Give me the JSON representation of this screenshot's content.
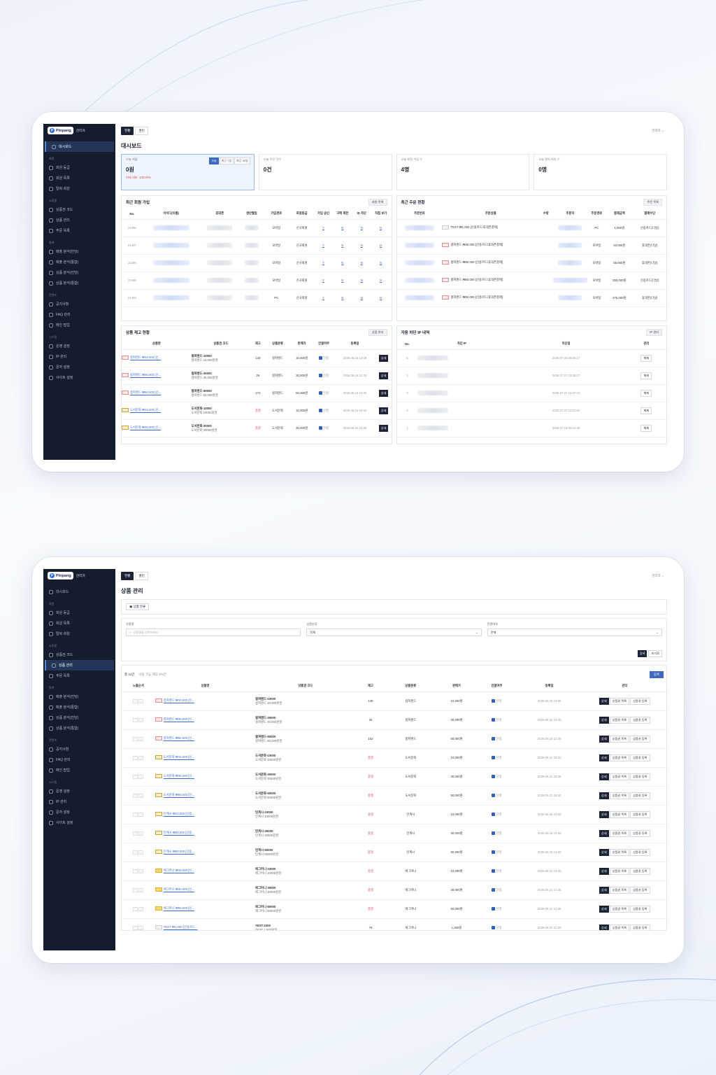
{
  "app": {
    "brand": "Pinpang",
    "role": "관리자",
    "tabs": [
      "현황",
      "쿨린"
    ],
    "user": "관리자 ⌄"
  },
  "sidebar": {
    "f1": [
      {
        "type": "item",
        "label": "대시보드",
        "icon": "dashboard-icon",
        "active": true
      },
      {
        "type": "sec",
        "label": "회원"
      },
      {
        "type": "item",
        "label": "회원 등급",
        "icon": "award-icon"
      },
      {
        "type": "item",
        "label": "회원 목록",
        "icon": "users-icon"
      },
      {
        "type": "item",
        "label": "탈퇴 회원",
        "icon": "user-x-icon"
      },
      {
        "type": "sec",
        "label": "쇼핑몰"
      },
      {
        "type": "item",
        "label": "상품권 코드",
        "icon": "ticket-icon"
      },
      {
        "type": "item",
        "label": "상품 관리",
        "icon": "box-icon"
      },
      {
        "type": "item",
        "label": "주문 목록",
        "icon": "cart-icon"
      },
      {
        "type": "sec",
        "label": "통계"
      },
      {
        "type": "item",
        "label": "매출 분석(빈당)",
        "icon": "chart-icon"
      },
      {
        "type": "item",
        "label": "매출 분석(통합)",
        "icon": "chart-icon"
      },
      {
        "type": "item",
        "label": "상품 분석(빈당)",
        "icon": "pie-icon"
      },
      {
        "type": "item",
        "label": "상품 분석(통합)",
        "icon": "pie-icon"
      },
      {
        "type": "sec",
        "label": "콘텐츠"
      },
      {
        "type": "item",
        "label": "공지사항",
        "icon": "bell-icon"
      },
      {
        "type": "item",
        "label": "FAQ 관리",
        "icon": "help-icon"
      },
      {
        "type": "item",
        "label": "메인 팝업",
        "icon": "popup-icon"
      },
      {
        "type": "sec",
        "label": "시스템"
      },
      {
        "type": "item",
        "label": "운영 설정",
        "icon": "sliders-icon"
      },
      {
        "type": "item",
        "label": "IP 관리",
        "icon": "shield-icon"
      },
      {
        "type": "item",
        "label": "문자 설정",
        "icon": "message-icon"
      },
      {
        "type": "item",
        "label": "사이트 설정",
        "icon": "settings-icon"
      }
    ],
    "f2_active": "상품 관리"
  },
  "dashboard": {
    "title": "대시보드",
    "stats": [
      {
        "label": "오늘 매출",
        "value": "0원",
        "delta": "어제 대비 -100.00%",
        "buttons": [
          "오늘",
          "최근 7일",
          "최근 30일"
        ]
      },
      {
        "label": "오늘 주문 건수",
        "value": "0건"
      },
      {
        "label": "오늘 회원 가입 수",
        "value": "4명"
      },
      {
        "label": "오늘 탈퇴 회원 수",
        "value": "0명"
      }
    ],
    "members": {
      "title": "최근 회원 가입",
      "button": "회원 목록",
      "headers": [
        "No.",
        "아이디(이름)",
        "휴대폰",
        "생년월일",
        "가입경로",
        "회원등급",
        "가입 승인",
        "구매 제한",
        "ID 차단",
        "직접 보기"
      ],
      "rows": [
        {
          "no": "21498",
          "route": "모바일",
          "grade": "신규회원",
          "a": "Y",
          "b": "N",
          "c": "N",
          "d": "N"
        },
        {
          "no": "21497",
          "route": "모바일",
          "grade": "신규회원",
          "a": "Y",
          "b": "N",
          "c": "N",
          "d": "N"
        },
        {
          "no": "21496",
          "route": "모바일",
          "grade": "신규회원",
          "a": "Y",
          "b": "N",
          "c": "N",
          "d": "N"
        },
        {
          "no": "21495",
          "route": "모바일",
          "grade": "신규회원",
          "a": "Y",
          "b": "N",
          "c": "N",
          "d": "N"
        },
        {
          "no": "21494",
          "route": "PC",
          "grade": "신규회원",
          "a": "Y",
          "b": "N",
          "c": "N",
          "d": "N"
        }
      ]
    },
    "orders": {
      "title": "최근 주문 현황",
      "button": "주문 목록",
      "headers": [
        "주문번호",
        "주문상품",
        "수량",
        "주문자",
        "주문경로",
        "결제금액",
        "결제수단"
      ],
      "rows": [
        {
          "product": "TEST ₩1,000 [신용카드/휴대폰결제]",
          "channel": "PC",
          "amount": "1,000원",
          "method": "신용카드(다날)"
        },
        {
          "product": "컬쳐랜드 ₩30,000 [신용카드/휴대폰결제]",
          "channel": "모바일",
          "amount": "33,000원",
          "method": "휴대폰(다날)"
        },
        {
          "product": "컬쳐랜드 ₩50,000 [신용카드/휴대폰결제]",
          "channel": "모바일",
          "amount": "55,000원",
          "method": "휴대폰(다날)"
        },
        {
          "product": "컬쳐랜드 ₩50,000 [신용카드/휴대폰결제]",
          "channel": "모바일",
          "amount": "250,000원",
          "method": "신용카드(다날)"
        },
        {
          "product": "컬쳐랜드 ₩50,000 [신용카드/휴대폰결제]",
          "channel": "모바일",
          "amount": "275,000원",
          "method": "휴대폰(다날)"
        }
      ]
    },
    "stock": {
      "title": "상품 재고 현황",
      "button": "상품 관리",
      "headers": [
        "상품명",
        "상품권 코드",
        "재고",
        "상품분류",
        "판매가",
        "진열여부",
        "등록일",
        ""
      ],
      "rows": [
        {
          "name": "컬쳐랜드 ₩10,000 [신...",
          "code": "컬쳐랜드-10000",
          "sub": "컬쳐랜드 10,000원권",
          "stock": "149",
          "cat": "컬쳐랜드",
          "price": "10,000원",
          "show": "진열",
          "date": "2026.06.15 13:08",
          "btn": "상세"
        },
        {
          "name": "컬쳐랜드 ₩30,000 [신...",
          "code": "컬쳐랜드-30000",
          "sub": "컬쳐랜드 30,000원권",
          "stock": "26",
          "cat": "컬쳐랜드",
          "price": "30,000원",
          "show": "진열",
          "date": "2026.06.16 12:43",
          "btn": "상세"
        },
        {
          "name": "컬쳐랜드 ₩50,000 [신...",
          "code": "컬쳐랜드-50000",
          "sub": "컬쳐랜드 50,000원권",
          "stock": "172",
          "cat": "컬쳐랜드",
          "price": "50,000원",
          "show": "진열",
          "date": "2026.06.16 12:46",
          "btn": "상세"
        },
        {
          "name": "도서문화 ₩10,000 [신...",
          "code": "도서문화-10000",
          "sub": "도서문화 10000원권",
          "stock": "품절",
          "cat": "도서문화",
          "price": "10,000원",
          "show": "진열",
          "date": "2026.06.21 19:34",
          "btn": "상세"
        },
        {
          "name": "도서문화 ₩30,000 [신...",
          "code": "도서문화-30000",
          "sub": "도서문화 30000원권",
          "stock": "품절",
          "cat": "도서문화",
          "price": "30,000원",
          "show": "진열",
          "date": "2026.06.21 19:36",
          "btn": "상세"
        }
      ]
    },
    "ipblock": {
      "title": "자동 차단 IP 내역",
      "button": "IP 관리",
      "headers": [
        "No.",
        "차단 IP",
        "차단일",
        "관리"
      ],
      "rows": [
        {
          "no": "5",
          "date": "2026.07.28 06:58:17",
          "btn": "해제"
        },
        {
          "no": "4",
          "date": "2026.07.27 22:45:27",
          "btn": "해제"
        },
        {
          "no": "3",
          "date": "2026.07.27 11:07:44",
          "btn": "해제"
        },
        {
          "no": "2",
          "date": "2026.07.27 11:01:51",
          "btn": "해제"
        },
        {
          "no": "1",
          "date": "2026.07.18 06:31:45",
          "btn": "해제"
        }
      ]
    }
  },
  "products": {
    "title": "상품 관리",
    "category_button": "상품 분류",
    "filters": {
      "name_label": "상품명",
      "name_placeholder": "상품명을 입력하세요",
      "cat_label": "상품분류",
      "cat_value": "전체",
      "show_label": "진열여부",
      "show_value": "전체",
      "search": "검색",
      "reset": "초기화"
    },
    "count": "총 13건",
    "count_sub": "사용 가능 재고 4%건",
    "register": "등록",
    "headers": [
      "노출순서",
      "상품명",
      "상품권 코드",
      "재고",
      "상품분류",
      "판매가",
      "진열여부",
      "등록일",
      "관리"
    ],
    "actions": [
      "상세",
      "상품권 목록",
      "상품권 등록"
    ],
    "rows": [
      {
        "name": "컬쳐랜드 ₩10,000 [신...",
        "code": "컬쳐랜드-10000",
        "sub": "컬쳐랜드 10,000원권",
        "stock": "149",
        "cat": "컬쳐랜드",
        "price": "10,000원",
        "show": "진열",
        "date": "2026.06.15 13:08",
        "th": "r"
      },
      {
        "name": "컬쳐랜드 ₩30,000 [신...",
        "code": "컬쳐랜드-30000",
        "sub": "컬쳐랜드 30,000원권",
        "stock": "26",
        "cat": "컬쳐랜드",
        "price": "30,000원",
        "show": "진열",
        "date": "2026.06.16 12:43",
        "th": "r"
      },
      {
        "name": "컬쳐랜드 ₩50,000 [신...",
        "code": "컬쳐랜드-50000",
        "sub": "컬쳐랜드 50,000원권",
        "stock": "162",
        "cat": "컬쳐랜드",
        "price": "50,000원",
        "show": "진열",
        "date": "2026.06.16 12:46",
        "th": "r"
      },
      {
        "name": "도서문화 ₩10,000 [신...",
        "code": "도서문화-10000",
        "sub": "도서문화 10000원권",
        "stock": "품절",
        "cat": "도서문화",
        "price": "10,000원",
        "show": "진열",
        "date": "2026.06.21 19:34",
        "th": "y"
      },
      {
        "name": "도서문화 ₩30,000 [신...",
        "code": "도서문화-30000",
        "sub": "도서문화 30000원권",
        "stock": "품절",
        "cat": "도서문화",
        "price": "30,000원",
        "show": "진열",
        "date": "2026.06.21 19:36",
        "th": "y"
      },
      {
        "name": "도서문화 ₩50,000 [신...",
        "code": "도서문화-50000",
        "sub": "도서문화 50000원권",
        "stock": "품절",
        "cat": "도서문화",
        "price": "50,000원",
        "show": "진열",
        "date": "2026.06.21 19:42",
        "th": "y"
      },
      {
        "name": "틴캐시 ₩10,000 [신용...",
        "code": "틴캐시-10000",
        "sub": "틴캐시 10000원권",
        "stock": "품절",
        "cat": "틴캐시",
        "price": "10,000원",
        "show": "진열",
        "date": "2026.06.16 13:03",
        "th": "y"
      },
      {
        "name": "틴캐시 ₩30,000 [신용...",
        "code": "틴캐시-30000",
        "sub": "틴캐시 30000원권",
        "stock": "품절",
        "cat": "틴캐시",
        "price": "30,000원",
        "show": "진열",
        "date": "2026.06.16 14:02",
        "th": "y"
      },
      {
        "name": "틴캐시 ₩50,000 [신용...",
        "code": "틴캐시-50000",
        "sub": "틴캐시 50000원권",
        "stock": "품절",
        "cat": "틴캐시",
        "price": "50,000원",
        "show": "진열",
        "date": "2026.06.16 14:03",
        "th": "y"
      },
      {
        "name": "에그머니 ₩10,000 [신...",
        "code": "에그머니-10000",
        "sub": "에그머니 10000원권",
        "stock": "품절",
        "cat": "에그머니",
        "price": "10,000원",
        "show": "진열",
        "date": "2026.06.21 14:43",
        "th": "d"
      },
      {
        "name": "에그머니 ₩30,000 [신...",
        "code": "에그머니-30000",
        "sub": "에그머니 30000원권",
        "stock": "품절",
        "cat": "에그머니",
        "price": "30,000원",
        "show": "진열",
        "date": "2026.06.21 14:45",
        "th": "d"
      },
      {
        "name": "에그머니 ₩50,000 [신...",
        "code": "에그머니-50000",
        "sub": "에그머니 50000원권",
        "stock": "품절",
        "cat": "에그머니",
        "price": "50,000원",
        "show": "진열",
        "date": "2026.06.21 14:46",
        "th": "d"
      },
      {
        "name": "TEST ₩1,000 [신용카드...",
        "code": "TEST-1000",
        "sub": "TEST 1,000원권",
        "stock": "79",
        "cat": "에그머니",
        "price": "1,000원",
        "show": "진열",
        "date": "2026.06.22 21:20",
        "th": "g"
      }
    ]
  },
  "colors": {
    "sidebar": "#141c2e",
    "accent": "#3d67c0",
    "soldout": "#e04a4a"
  }
}
